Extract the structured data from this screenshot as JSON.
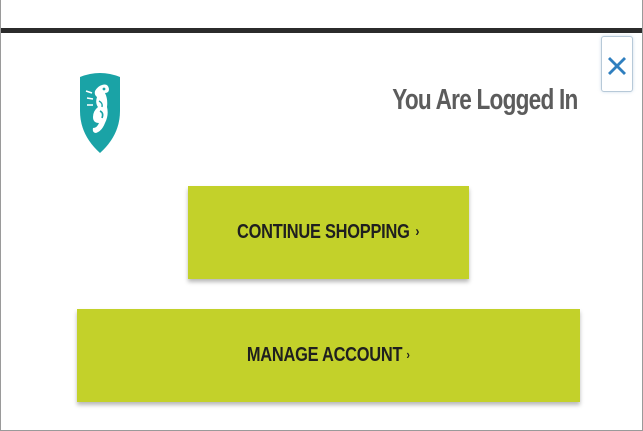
{
  "dialog": {
    "title": "You Are Logged In",
    "close_label": "×",
    "colors": {
      "button_bg": "#c3d12a",
      "logo_teal": "#1aa3a6",
      "title_text": "#5c5c5c",
      "close_x": "#2f7fbf"
    }
  },
  "icons": {
    "logo": "seahorse-shield-logo",
    "close": "close-icon",
    "chevron": "chevron-right-icon"
  },
  "buttons": {
    "continue_label": "CONTINUE SHOPPING",
    "continue_chevron": "›",
    "manage_label": "MANAGE ACCOUNT",
    "manage_chevron": "›"
  }
}
